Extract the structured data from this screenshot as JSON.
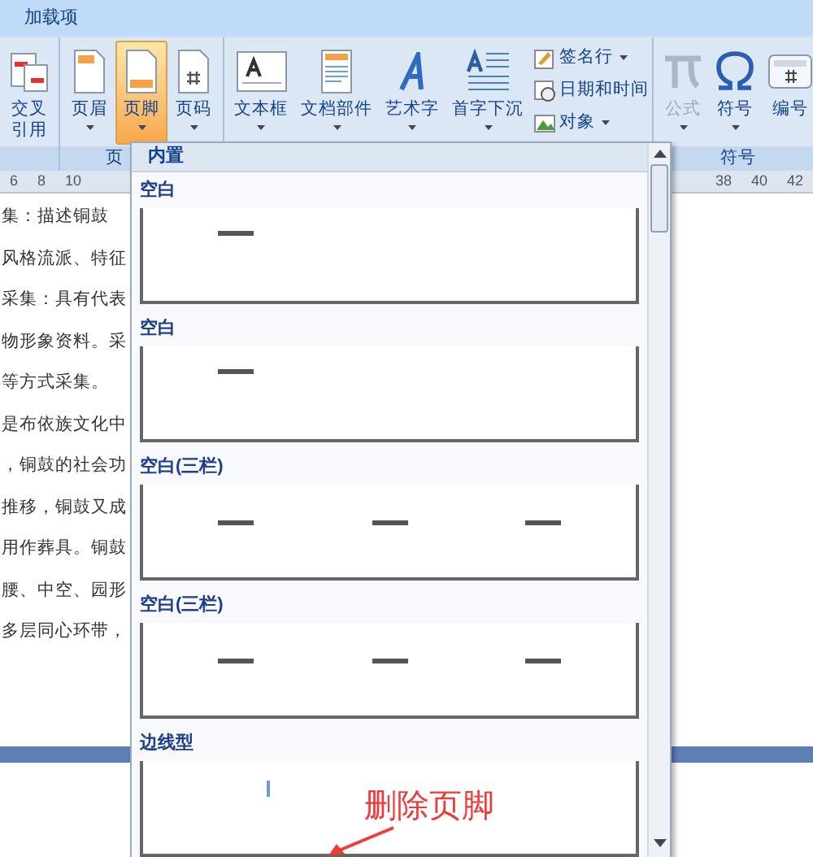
{
  "ribbon_tab": {
    "label": "加载项"
  },
  "groups": [
    {
      "buttons": [
        {
          "kind": "large",
          "label": "交叉引用",
          "dropdown": false,
          "selected": false,
          "disabled": false
        }
      ]
    },
    {
      "label": "页",
      "buttons": [
        {
          "kind": "large",
          "label": "页眉",
          "dropdown": true,
          "selected": false,
          "disabled": false
        },
        {
          "kind": "large",
          "label": "页脚",
          "dropdown": true,
          "selected": true,
          "disabled": false
        },
        {
          "kind": "large",
          "label": "页码",
          "dropdown": true,
          "selected": false,
          "disabled": false
        }
      ]
    },
    {
      "buttons": [
        {
          "kind": "large",
          "label": "文本框",
          "dropdown": true,
          "selected": false,
          "disabled": false
        },
        {
          "kind": "large",
          "label": "文档部件",
          "dropdown": true,
          "selected": false,
          "disabled": false
        },
        {
          "kind": "large",
          "label": "艺术字",
          "dropdown": true,
          "selected": false,
          "disabled": false
        },
        {
          "kind": "large",
          "label": "首字下沉",
          "dropdown": true,
          "selected": false,
          "disabled": false
        },
        {
          "kind": "small_stack",
          "items": [
            {
              "label": "签名行",
              "dropdown": true
            },
            {
              "label": "日期和时间",
              "dropdown": false
            },
            {
              "label": "对象",
              "dropdown": true
            }
          ]
        }
      ]
    },
    {
      "label": "符号",
      "buttons": [
        {
          "kind": "large",
          "label": "公式",
          "dropdown": true,
          "selected": false,
          "disabled": true
        },
        {
          "kind": "large",
          "label": "符号",
          "dropdown": true,
          "selected": false,
          "disabled": false
        },
        {
          "kind": "large",
          "label": "编号",
          "dropdown": false,
          "selected": false,
          "disabled": false
        }
      ]
    }
  ],
  "ruler": {
    "left_ticks": [
      "6",
      "8",
      "10"
    ],
    "right_ticks": [
      "38",
      "40",
      "42"
    ]
  },
  "document_lines": [
    "集：描述铜鼓",
    "风格流派、特征",
    "采集：具有代表",
    "物形象资料。采",
    "等方式采集。",
    "是布依族文化中",
    "，铜鼓的社会功",
    "推移，铜鼓又成",
    "用作葬具。铜鼓",
    "腰、中空、园形",
    "多层同心环带，"
  ],
  "footer_menu": {
    "title": "内置",
    "sections": [
      {
        "label": "空白",
        "kind": "single"
      },
      {
        "label": "空白",
        "kind": "single"
      },
      {
        "label": "空白(三栏)",
        "kind": "three"
      },
      {
        "label": "空白(三栏)",
        "kind": "three"
      },
      {
        "label": "边线型",
        "kind": "border"
      }
    ]
  },
  "annotation": {
    "text": "删除页脚"
  }
}
